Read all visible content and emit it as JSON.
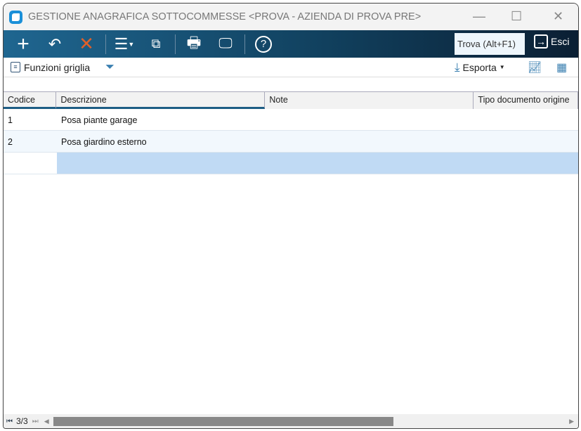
{
  "window": {
    "title": "GESTIONE ANAGRAFICA SOTTOCOMMESSE <PROVA - AZIENDA DI PROVA PRE>"
  },
  "toolbar": {
    "find_placeholder": "Trova (Alt+F1)",
    "exit_label": "Esci"
  },
  "subtoolbar": {
    "grid_functions_label": "Funzioni griglia",
    "export_label": "Esporta"
  },
  "grid": {
    "columns": [
      "Codice",
      "Descrizione",
      "Note",
      "Tipo documento origine"
    ],
    "rows": [
      {
        "codice": "1",
        "descrizione": "Posa piante garage",
        "note": "",
        "tipo": ""
      },
      {
        "codice": "2",
        "descrizione": "Posa giardino esterno",
        "note": "",
        "tipo": ""
      }
    ]
  },
  "footer": {
    "record_counter": "3/3"
  }
}
